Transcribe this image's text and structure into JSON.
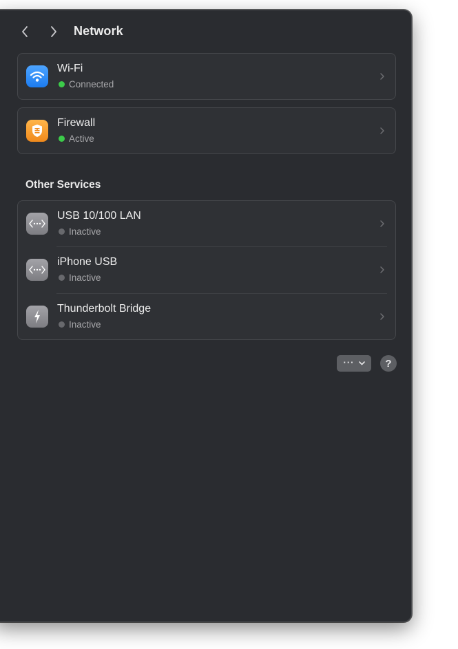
{
  "header": {
    "title": "Network",
    "back_icon": "chevron-left-icon",
    "forward_icon": "chevron-right-icon"
  },
  "primary_services": [
    {
      "name": "Wi-Fi",
      "status": "Connected",
      "status_color": "#3ccb4a",
      "icon": "wifi-icon",
      "icon_color": "#2a8cf5"
    },
    {
      "name": "Firewall",
      "status": "Active",
      "status_color": "#3ccb4a",
      "icon": "firewall-icon",
      "icon_color": "#f59a2c"
    }
  ],
  "other_services": {
    "title": "Other Services",
    "items": [
      {
        "name": "USB 10/100 LAN",
        "status": "Inactive",
        "status_color": "#68696d",
        "icon": "ethernet-icon"
      },
      {
        "name": "iPhone USB",
        "status": "Inactive",
        "status_color": "#68696d",
        "icon": "ethernet-icon"
      },
      {
        "name": "Thunderbolt Bridge",
        "status": "Inactive",
        "status_color": "#68696d",
        "icon": "thunderbolt-icon"
      }
    ]
  },
  "footer": {
    "more_label": "···",
    "more_icon": "chevron-down-icon",
    "help_label": "?"
  }
}
